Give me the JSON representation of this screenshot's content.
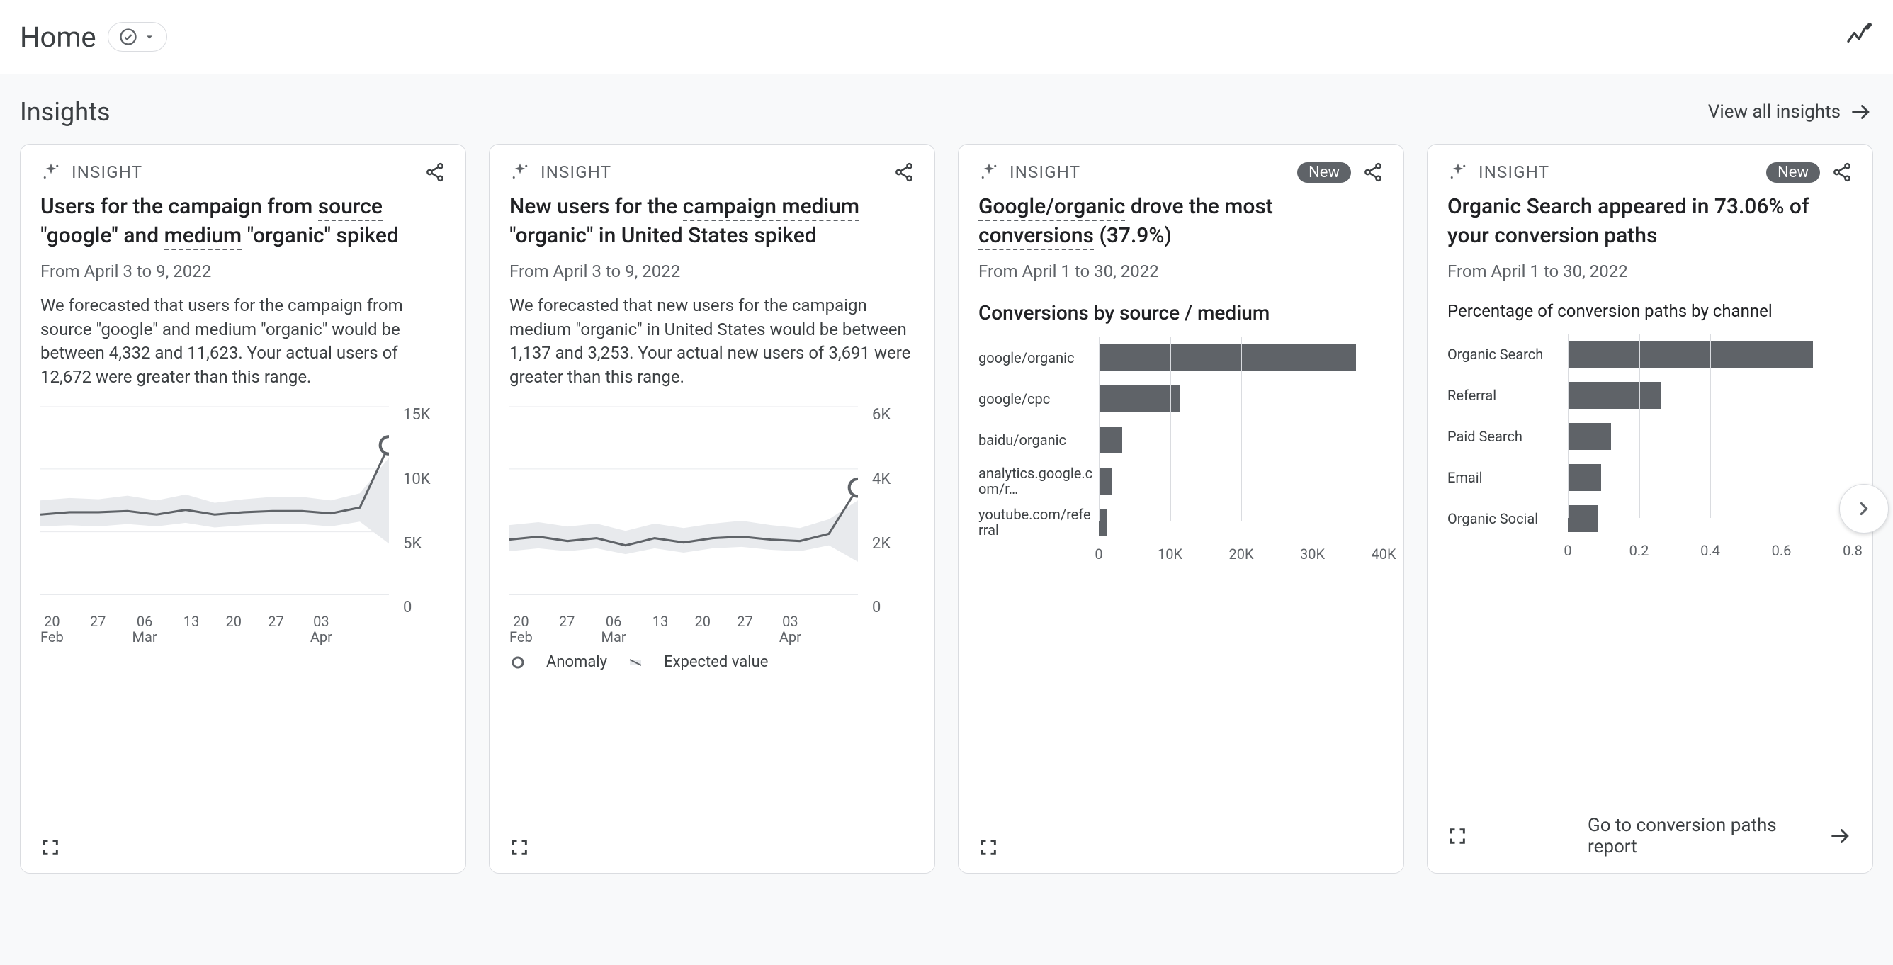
{
  "header": {
    "title": "Home"
  },
  "section": {
    "title": "Insights",
    "view_all": "View all insights"
  },
  "cards": [
    {
      "tag": "INSIGHT",
      "new": false,
      "title_html": "Users for the campaign from <span class='dashed'>source</span> \"google\" and <span class='dashed'>medium</span> \"organic\" spiked",
      "daterange": "From April 3 to 9, 2022",
      "desc": "We forecasted that users for the campaign from source \"google\" and medium \"organic\" would be between 4,332 and 11,623. Your actual users of 12,672 were greater than this range."
    },
    {
      "tag": "INSIGHT",
      "new": false,
      "title_html": "New users for the <span class='dashed'>campaign medium</span> \"organic\" in United States spiked",
      "daterange": "From April 3 to 9, 2022",
      "desc": "We forecasted that new users for the campaign medium \"organic\" in United States would be between 1,137 and 3,253. Your actual new users of 3,691 were greater than this range.",
      "legend": {
        "anomaly": "Anomaly",
        "expected": "Expected value"
      }
    },
    {
      "tag": "INSIGHT",
      "new": true,
      "new_label": "New",
      "title_html": "<span class='dashed'>Google/organic</span> drove the most <span class='dashed'>conversions</span> (37.9%)",
      "daterange": "From April 1 to 30, 2022",
      "subhead": "Conversions by source / medium"
    },
    {
      "tag": "INSIGHT",
      "new": true,
      "new_label": "New",
      "title_html": "Organic Search appeared in 73.06% of your conversion paths",
      "daterange": "From April 1 to 30, 2022",
      "subhead": "Percentage of conversion paths by channel",
      "go_link": "Go to conversion paths report"
    }
  ],
  "chart_data": [
    {
      "type": "line",
      "title": "Users anomaly",
      "x_labels": [
        "20 Feb",
        "27",
        "06 Mar",
        "13",
        "20",
        "27",
        "03 Apr"
      ],
      "y_ticks": [
        "15K",
        "10K",
        "5K",
        "0"
      ],
      "ylim": [
        0,
        16000
      ],
      "actual": [
        6800,
        7000,
        7000,
        7100,
        6800,
        7200,
        6800,
        7000,
        7100,
        7100,
        6900,
        7400,
        12672
      ],
      "expected_low": [
        5800,
        5900,
        5800,
        6000,
        5800,
        6100,
        5700,
        5900,
        6000,
        6000,
        5800,
        6200,
        4332
      ],
      "expected_high": [
        8000,
        8200,
        8100,
        8400,
        8000,
        8500,
        7800,
        8100,
        8300,
        8300,
        8000,
        8600,
        11623
      ]
    },
    {
      "type": "line",
      "title": "New users anomaly",
      "x_labels": [
        "20 Feb",
        "27",
        "06 Mar",
        "13",
        "20",
        "27",
        "03 Apr"
      ],
      "y_ticks": [
        "6K",
        "4K",
        "2K",
        "0"
      ],
      "ylim": [
        0,
        6500
      ],
      "actual": [
        1900,
        2000,
        1850,
        1950,
        1700,
        1950,
        1800,
        1950,
        2000,
        1900,
        1850,
        2100,
        3691
      ],
      "expected_low": [
        1500,
        1600,
        1500,
        1600,
        1400,
        1600,
        1450,
        1600,
        1650,
        1550,
        1500,
        1700,
        1137
      ],
      "expected_high": [
        2400,
        2500,
        2350,
        2450,
        2200,
        2450,
        2300,
        2450,
        2550,
        2400,
        2300,
        2600,
        3253
      ]
    },
    {
      "type": "bar",
      "orientation": "horizontal",
      "title": "Conversions by source / medium",
      "categories": [
        "google/organic",
        "google/cpc",
        "baidu/organic",
        "analytics.google.com/r…",
        "youtube.com/referral"
      ],
      "values": [
        37900,
        12000,
        3500,
        2000,
        1200
      ],
      "x_ticks": [
        "0",
        "10K",
        "20K",
        "30K",
        "40K"
      ],
      "xlim": [
        0,
        42000
      ]
    },
    {
      "type": "bar",
      "orientation": "horizontal",
      "title": "Percentage of conversion paths by channel",
      "categories": [
        "Organic Search",
        "Referral",
        "Paid Search",
        "Email",
        "Organic Social"
      ],
      "values": [
        0.7306,
        0.28,
        0.13,
        0.1,
        0.09
      ],
      "x_ticks": [
        "0",
        "0.2",
        "0.4",
        "0.6",
        "0.8"
      ],
      "xlim": [
        0,
        0.85
      ]
    }
  ]
}
